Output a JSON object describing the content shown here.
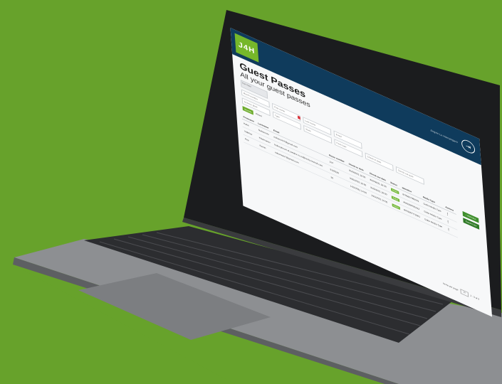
{
  "app": {
    "logo_text": "J4H",
    "user_name": "Jingxin Lu Hamyingara",
    "title": "Guest Passes",
    "subtitle": "All your guest passes",
    "hotel_select": "Test Hotel",
    "colors": {
      "header": "#0f3b5c",
      "brand_green": "#76b72a",
      "background": "#67a22b"
    }
  },
  "filters": {
    "room_number": "Room number",
    "first_name": "First name",
    "last_name": "Last name",
    "email": "Email",
    "license_plate": "Licence plate",
    "type": "Type",
    "state": "State",
    "pass_type": "Pass type",
    "check_in_date": "Check-in date",
    "check_out_date": "Check-out date",
    "date_example_1": "Example date: 15.6.2022",
    "date_example_2": "Example date: 15.6.2022"
  },
  "buttons": {
    "search": "Search",
    "reset": "Reset",
    "add": "+ Add New",
    "export": "Export CSV"
  },
  "table": {
    "headers": [
      "Firstname",
      "Lastname",
      "Email",
      "Room number",
      "Check-in date",
      "Check-out date",
      "Status",
      "Identifier",
      "Media Type",
      "Actions"
    ],
    "rows": [
      [
        "Kaka",
        "Nakamoto",
        "nakamoto7@gmail.com",
        "114",
        "8/20/2021 16:30",
        "8/20/2021 18:30",
        "Active",
        "8705607080001",
        "Gobo Media Type",
        "⋮"
      ],
      [
        "Vaibhav",
        "Kholmanov",
        "holemyheart.at.yandex-ru.ml@cmky.testrail.com",
        "3129129",
        "9/25/2021 16:30",
        "9/25/2021 18:30",
        "Active",
        "4543289785212",
        "Gobo Media Type",
        "⋮"
      ],
      [
        "Petr",
        "Fomin",
        "nakamoto7@gmail.com",
        "16",
        "1/15/2021 14:00",
        "1/15/2021 14:00",
        "Active",
        "9076657772001",
        "Gobo Media Type",
        "⋮"
      ]
    ]
  },
  "pager": {
    "rows_label": "Items per page",
    "rows_value": "10",
    "range": "1 - 3 of 3"
  }
}
